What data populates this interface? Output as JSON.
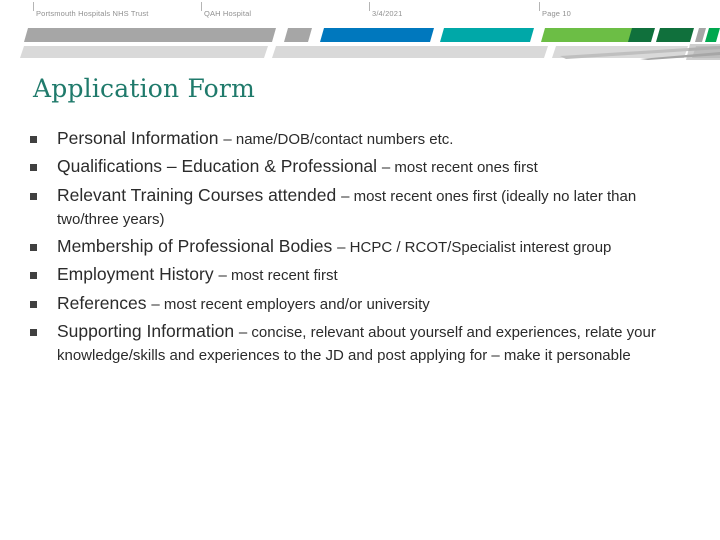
{
  "header": {
    "trust": "Portsmouth Hospitals NHS Trust",
    "site": "QAH Hospital",
    "date": "3/4/2021",
    "page": "Page 10"
  },
  "slide": {
    "title": "Application Form",
    "bullets": [
      {
        "lead": "Personal Information ",
        "detail": "– name/DOB/contact numbers etc."
      },
      {
        "lead": "Qualifications – Education & Professional ",
        "detail": "– most recent ones first"
      },
      {
        "lead": "Relevant Training Courses attended ",
        "detail": "– most recent ones first (ideally no later than two/three years)"
      },
      {
        "lead": "Membership of Professional Bodies ",
        "detail": "– HCPC / RCOT/Specialist interest group"
      },
      {
        "lead": "Employment History ",
        "detail": "– most recent first"
      },
      {
        "lead": "References ",
        "detail": "– most recent employers and/or university"
      },
      {
        "lead": "Supporting Information ",
        "detail": "– concise, relevant about yourself and experiences, relate your knowledge/skills and experiences to the JD and post applying for – make it personable"
      }
    ]
  },
  "colors": {
    "title_teal": "#1f7a6b",
    "banner_gray": "#a6a6a6",
    "banner_blue": "#0078be",
    "banner_teal": "#00a8a8",
    "banner_green": "#6cbe45",
    "banner_dark_green": "#10703c",
    "banner_bright_green": "#00a84f",
    "banner_light_gray": "#d9d9d9",
    "banner_mid_gray": "#bfbfbf",
    "bullet_marker": "#404040",
    "body_text": "#2b2b2b",
    "header_text": "#909090"
  }
}
